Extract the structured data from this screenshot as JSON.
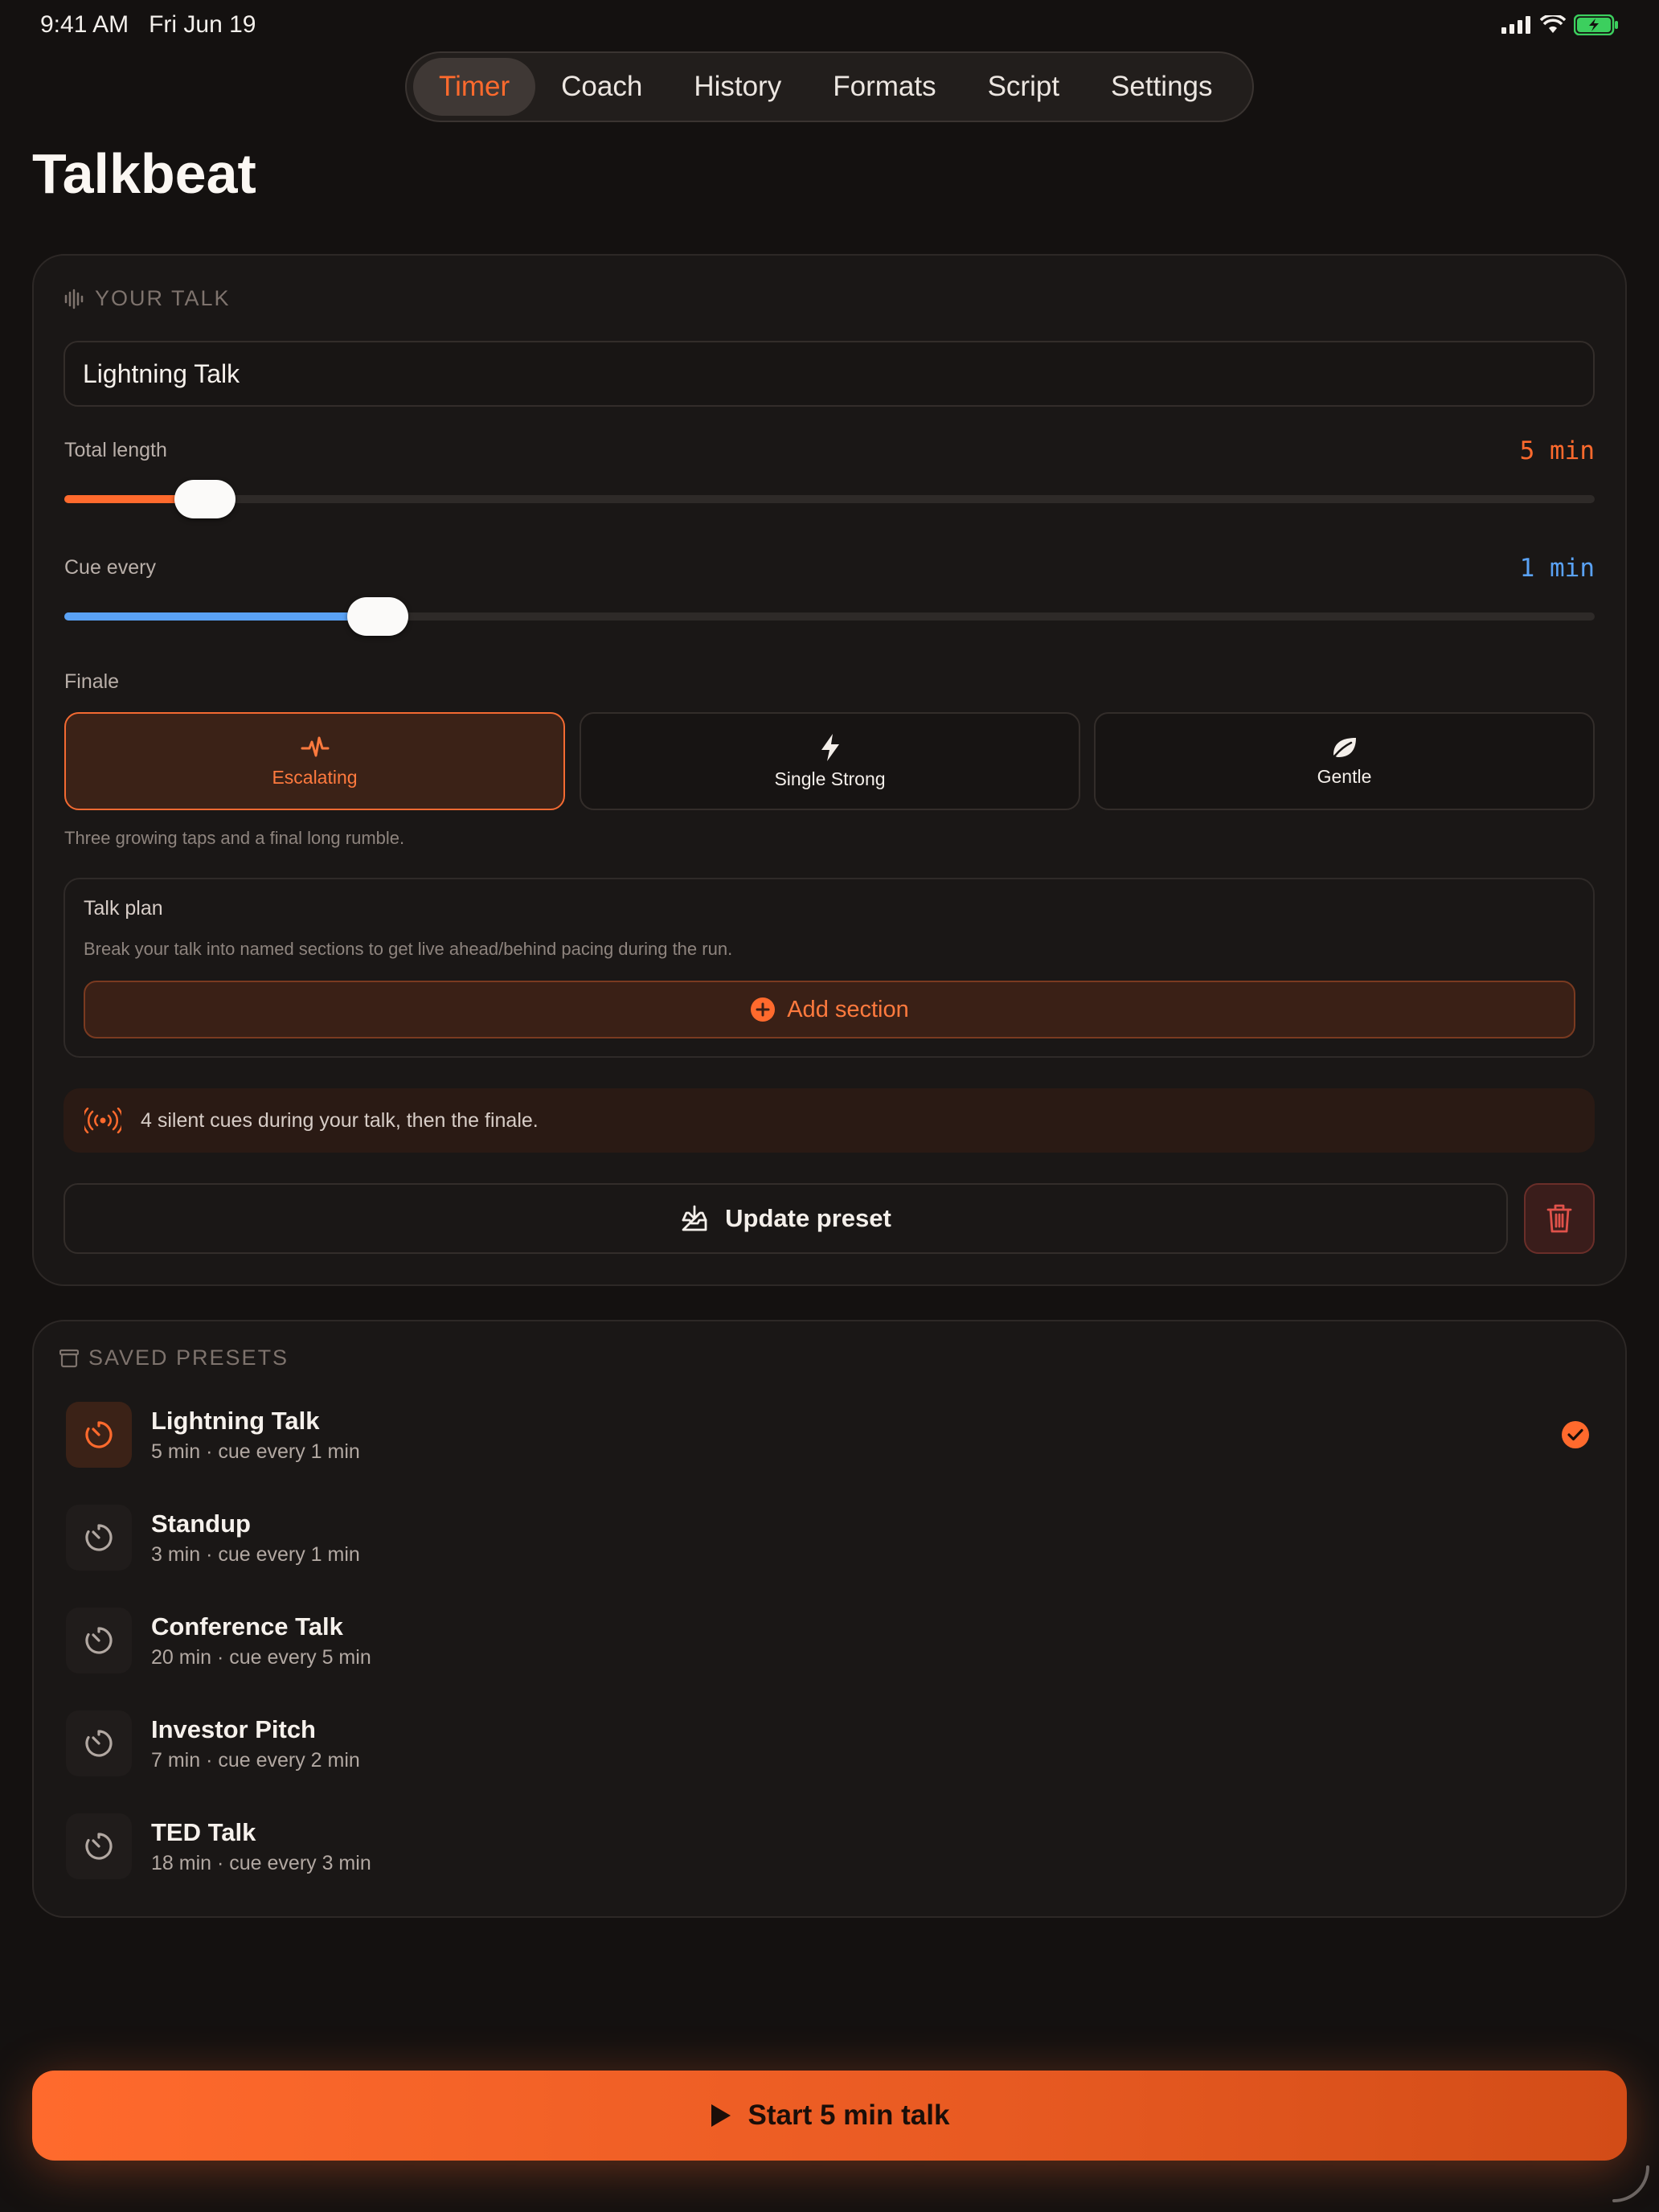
{
  "status": {
    "time": "9:41 AM",
    "date": "Fri Jun 19"
  },
  "tabs": [
    "Timer",
    "Coach",
    "History",
    "Formats",
    "Script",
    "Settings"
  ],
  "title": "Talkbeat",
  "your_talk": {
    "label": "YOUR TALK",
    "name_value": "Lightning Talk",
    "total_length": {
      "label": "Total length",
      "value_text": "5 min",
      "fraction": 0.092
    },
    "cue_every": {
      "label": "Cue every",
      "value_text": "1 min",
      "fraction": 0.205
    },
    "finale": {
      "label": "Finale",
      "options": [
        {
          "label": "Escalating",
          "icon": "pulse-icon",
          "selected": true
        },
        {
          "label": "Single Strong",
          "icon": "bolt-icon",
          "selected": false
        },
        {
          "label": "Gentle",
          "icon": "leaf-icon",
          "selected": false
        }
      ],
      "description": "Three growing taps and a final long rumble."
    },
    "plan": {
      "title": "Talk plan",
      "description": "Break your talk into named sections to get live ahead/behind pacing during the run.",
      "add_label": "Add section"
    },
    "info": "4 silent cues during your talk, then the finale.",
    "update_label": "Update preset"
  },
  "saved_presets": {
    "label": "SAVED PRESETS",
    "items": [
      {
        "name": "Lightning Talk",
        "meta": "5 min · cue every 1 min",
        "active": true
      },
      {
        "name": "Standup",
        "meta": "3 min · cue every 1 min",
        "active": false
      },
      {
        "name": "Conference Talk",
        "meta": "20 min · cue every 5 min",
        "active": false
      },
      {
        "name": "Investor Pitch",
        "meta": "7 min · cue every 2 min",
        "active": false
      },
      {
        "name": "TED Talk",
        "meta": "18 min · cue every 3 min",
        "active": false
      }
    ]
  },
  "start_label": "Start 5 min talk",
  "colors": {
    "accent": "#ff6a2d",
    "blue": "#5aa2f5",
    "background": "#141110"
  }
}
